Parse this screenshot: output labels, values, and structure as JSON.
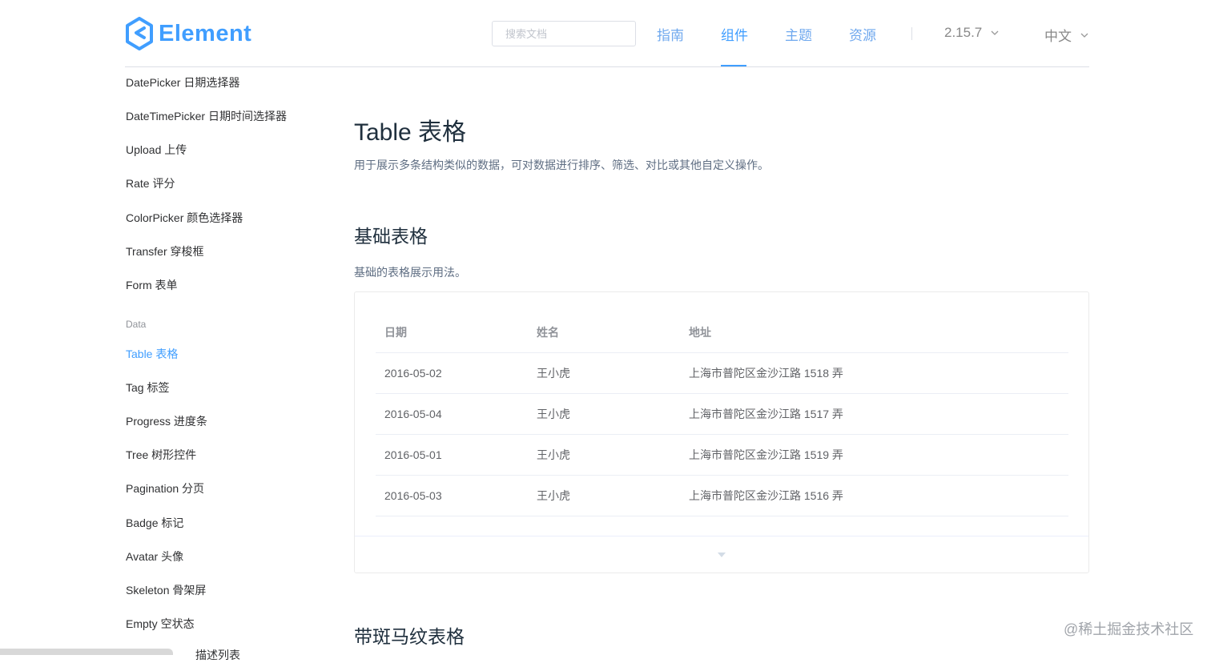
{
  "header": {
    "logo_text": "Element",
    "search_placeholder": "搜索文档",
    "nav": [
      {
        "label": "指南"
      },
      {
        "label": "组件"
      },
      {
        "label": "主题"
      },
      {
        "label": "资源"
      }
    ],
    "version": "2.15.7",
    "language": "中文",
    "accent_color": "#409eff"
  },
  "sidebar": {
    "items_top": [
      {
        "label": "DatePicker 日期选择器"
      },
      {
        "label": "DateTimePicker 日期时间选择器"
      },
      {
        "label": "Upload 上传"
      },
      {
        "label": "Rate 评分"
      },
      {
        "label": "ColorPicker 颜色选择器"
      },
      {
        "label": "Transfer 穿梭框"
      },
      {
        "label": "Form 表单"
      }
    ],
    "group_label": "Data",
    "items_data": [
      {
        "label": "Table 表格"
      },
      {
        "label": "Tag 标签"
      },
      {
        "label": "Progress 进度条"
      },
      {
        "label": "Tree 树形控件"
      },
      {
        "label": "Pagination 分页"
      },
      {
        "label": "Badge 标记"
      },
      {
        "label": "Avatar 头像"
      },
      {
        "label": "Skeleton 骨架屏"
      },
      {
        "label": "Empty 空状态"
      }
    ],
    "partial_item": "描述列表"
  },
  "main": {
    "title": "Table 表格",
    "description": "用于展示多条结构类似的数据，可对数据进行排序、筛选、对比或其他自定义操作。",
    "section1": {
      "title": "基础表格",
      "description": "基础的表格展示用法。"
    },
    "table": {
      "headers": [
        "日期",
        "姓名",
        "地址"
      ],
      "rows": [
        [
          "2016-05-02",
          "王小虎",
          "上海市普陀区金沙江路 1518 弄"
        ],
        [
          "2016-05-04",
          "王小虎",
          "上海市普陀区金沙江路 1517 弄"
        ],
        [
          "2016-05-01",
          "王小虎",
          "上海市普陀区金沙江路 1519 弄"
        ],
        [
          "2016-05-03",
          "王小虎",
          "上海市普陀区金沙江路 1516 弄"
        ]
      ]
    },
    "section2": {
      "title": "带斑马纹表格"
    }
  },
  "watermark": "@稀土掘金技术社区"
}
